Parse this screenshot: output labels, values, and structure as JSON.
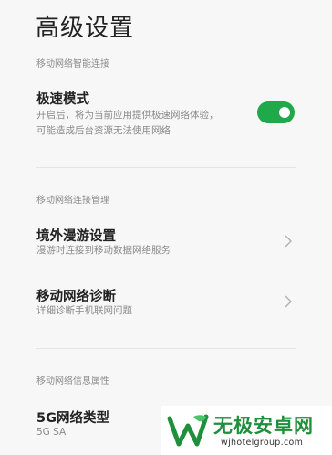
{
  "page": {
    "title": "高级设置"
  },
  "sections": [
    {
      "header": "移动网络智能连接",
      "items": [
        {
          "title": "极速模式",
          "subtitle_lines": [
            "开启后，将为当前应用提供极速网络体验，",
            "可能造成后台资源无法使用网络"
          ],
          "control": "toggle",
          "toggle_on": true
        }
      ]
    },
    {
      "header": "移动网络连接管理",
      "items": [
        {
          "title": "境外漫游设置",
          "subtitle": "漫游时连接到移动数据网络服务",
          "control": "chevron-right-icon"
        },
        {
          "title": "移动网络诊断",
          "subtitle": "详细诊断手机联网问题",
          "control": "chevron-right-icon"
        }
      ]
    },
    {
      "header": "移动网络信息属性",
      "items": [
        {
          "title": "5G网络类型",
          "subtitle": "5G SA"
        }
      ]
    }
  ],
  "watermark": {
    "title": "无极安卓网",
    "url": "wjhotelgroup.com",
    "icon": "leaf-w-logo-icon"
  },
  "colors": {
    "toggle_on": "#1fa94a",
    "watermark_green": "#1e8f3a"
  }
}
